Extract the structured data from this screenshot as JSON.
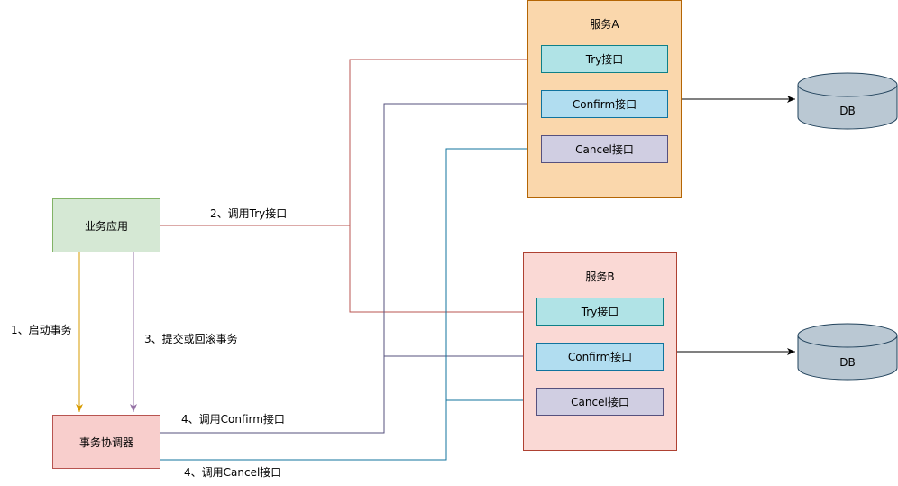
{
  "nodes": {
    "biz_app": "业务应用",
    "coordinator": "事务协调器",
    "service_a": {
      "title": "服务A",
      "try": "Try接口",
      "confirm": "Confirm接口",
      "cancel": "Cancel接口"
    },
    "service_b": {
      "title": "服务B",
      "try": "Try接口",
      "confirm": "Confirm接口",
      "cancel": "Cancel接口"
    },
    "db_a": "DB",
    "db_b": "DB"
  },
  "edges": {
    "start_tx": "1、启动事务",
    "call_try": "2、调用Try接口",
    "commit_rollback": "3、提交或回滚事务",
    "call_confirm": "4、调用Confirm接口",
    "call_cancel": "4、调用Cancel接口"
  },
  "colors": {
    "try_edge": "#b85450",
    "confirm_edge": "#56517e",
    "cancel_edge": "#10739e",
    "start_edge": "#d79b00",
    "commit_edge": "#9673a6",
    "app_fill": "#d5e8d4",
    "app_stroke": "#82b366",
    "coord_fill": "#f8cecc",
    "coord_stroke": "#b85450",
    "svc_a_fill": "#fad7ac",
    "svc_a_stroke": "#b46504",
    "svc_b_fill": "#fad9d5",
    "svc_b_stroke": "#ae4132",
    "try_fill": "#b0e3e6",
    "try_stroke": "#0e8088",
    "confirm_fill": "#b1ddf0",
    "confirm_stroke": "#10739e",
    "cancel_fill": "#d0cee2",
    "cancel_stroke": "#56517e",
    "db_fill": "#bac8d3",
    "db_stroke": "#23445d"
  }
}
